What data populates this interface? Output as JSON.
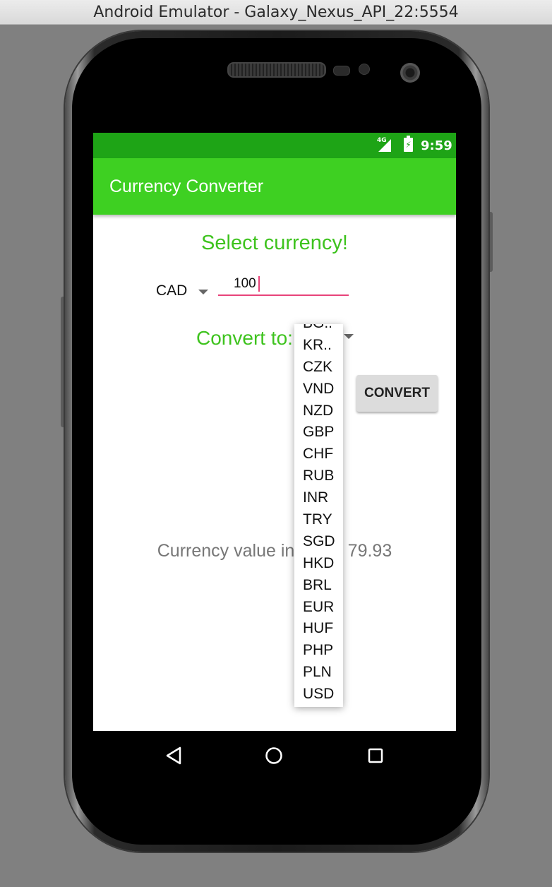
{
  "window": {
    "title": "Android Emulator - Galaxy_Nexus_API_22:5554"
  },
  "statusbar": {
    "network": "4G",
    "time": "9:59",
    "icons": [
      "signal-icon",
      "battery-charging-icon"
    ]
  },
  "appbar": {
    "title": "Currency Converter",
    "color": "#3ed022"
  },
  "main": {
    "heading": "Select currency!",
    "from_currency": "CAD",
    "amount_value": "100",
    "convert_to_label": "Convert to:",
    "convert_button": "CONVERT",
    "result_prefix": "Currency value in U",
    "result_suffix": "s: 79.93"
  },
  "dropdown": {
    "options": [
      "BG..",
      "KR..",
      "CZK",
      "VND",
      "NZD",
      "GBP",
      "CHF",
      "RUB",
      "INR",
      "TRY",
      "SGD",
      "HKD",
      "BRL",
      "EUR",
      "HUF",
      "PHP",
      "PLN",
      "USD"
    ]
  },
  "colors": {
    "accent": "#3ec31e",
    "statusbar": "#1ea416",
    "input_underline": "#e8437a"
  }
}
